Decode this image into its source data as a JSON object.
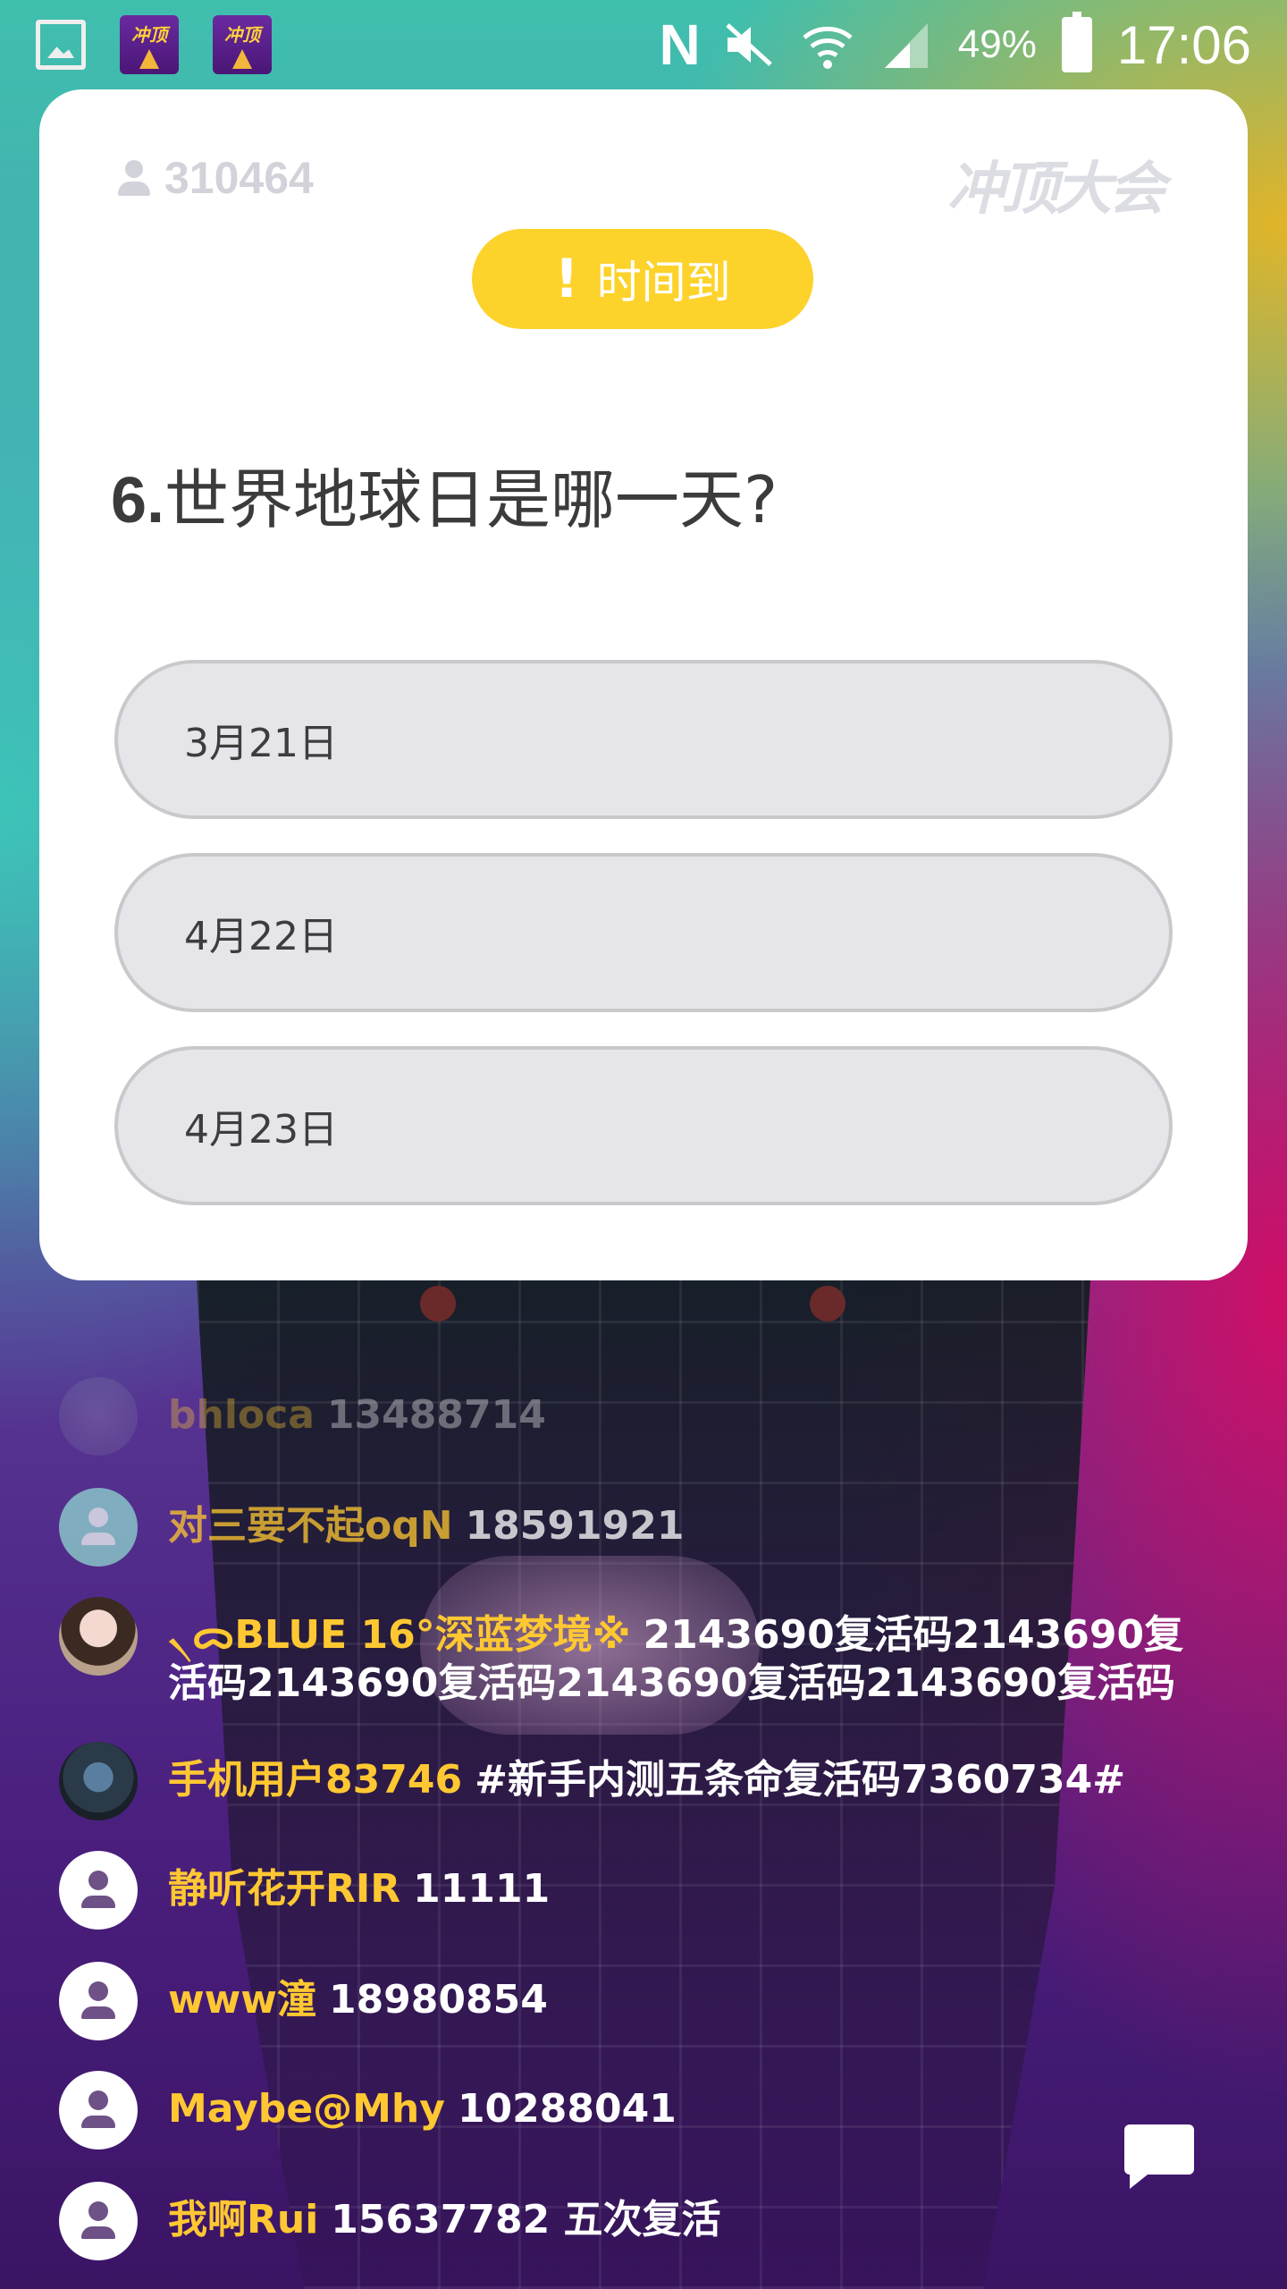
{
  "status_bar": {
    "app_icon_1_label": "冲顶",
    "app_icon_2_label": "冲顶",
    "network_letter": "N",
    "battery_percent": "49%",
    "time": "17:06"
  },
  "quiz": {
    "player_count": "310464",
    "brand": "冲顶大会",
    "badge_icon": "!",
    "badge_label": "时间到",
    "question_number": "6.",
    "question_text": "世界地球日是哪一天?",
    "options": [
      {
        "label": "3月21日"
      },
      {
        "label": "4月22日"
      },
      {
        "label": "4月23日"
      }
    ]
  },
  "comments": [
    {
      "name": "bhloca",
      "message": "13488714"
    },
    {
      "name": "对三要不起oqN",
      "message": "18591921"
    },
    {
      "name": "৲ᯅBLUE 16°深蓝梦境※",
      "message": "2143690复活码2143690复活码2143690复活码2143690复活码2143690复活码"
    },
    {
      "name": "手机用户83746",
      "message": "#新手内测五条命复活码7360734#"
    },
    {
      "name": "静听花开RIR",
      "message": "11111"
    },
    {
      "name": "www潼",
      "message": "18980854"
    },
    {
      "name": "Maybe@Mhy",
      "message": "10288041"
    },
    {
      "name": "我啊Rui",
      "message": "15637782 五次复活"
    }
  ],
  "colors": {
    "badge": "#fdd22a",
    "username": "#ffc832",
    "option_bg": "#e6e6ea"
  }
}
